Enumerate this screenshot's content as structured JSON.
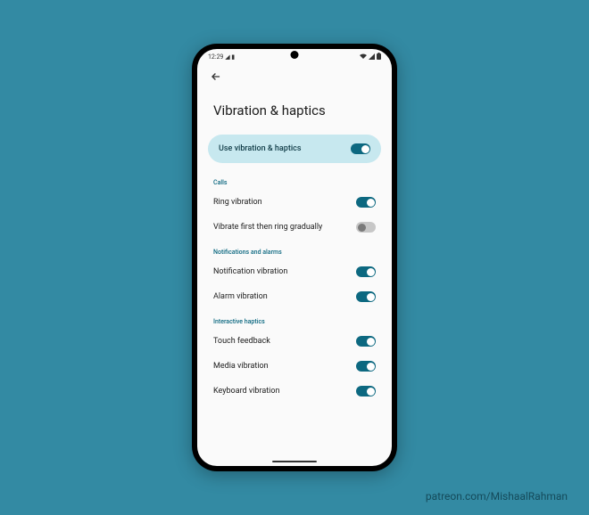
{
  "status": {
    "time": "12:29",
    "leftIcons": "◢ ▮",
    "rightIcons": "◢ ▮"
  },
  "header": {
    "title": "Vibration & haptics"
  },
  "master": {
    "label": "Use vibration & haptics",
    "on": true
  },
  "sections": {
    "calls": {
      "header": "Calls",
      "ring": {
        "label": "Ring vibration",
        "on": true
      },
      "vibrateFirst": {
        "label": "Vibrate first then ring gradually",
        "on": false
      }
    },
    "notif": {
      "header": "Notifications and alarms",
      "notification": {
        "label": "Notification vibration",
        "on": true
      },
      "alarm": {
        "label": "Alarm vibration",
        "on": true
      }
    },
    "interactive": {
      "header": "Interactive haptics",
      "touch": {
        "label": "Touch feedback",
        "on": true
      },
      "media": {
        "label": "Media vibration",
        "on": true
      },
      "keyboard": {
        "label": "Keyboard vibration",
        "on": true
      }
    }
  },
  "watermark": "patreon.com/MishaalRahman"
}
